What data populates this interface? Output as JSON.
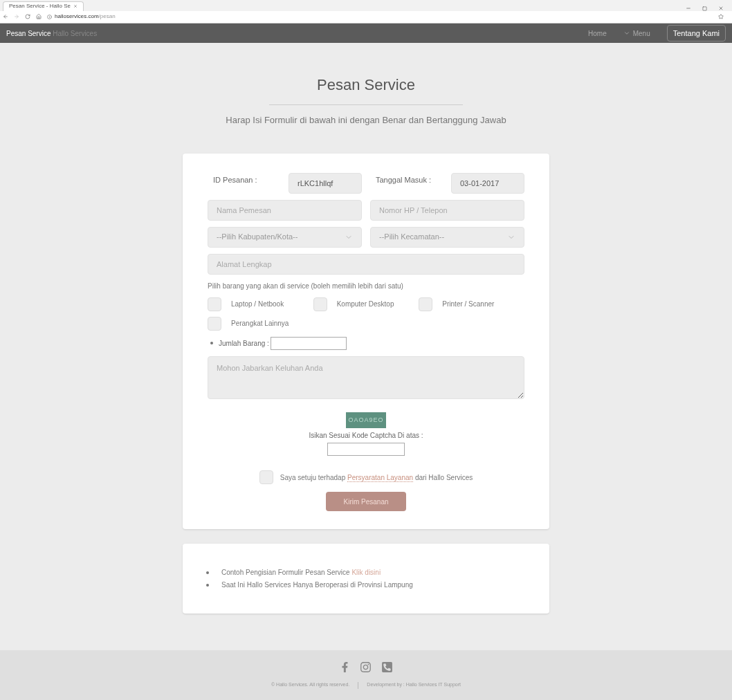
{
  "browser": {
    "tab_title": "Pesan Service - Hallo Se",
    "url_host": "halloservices.com",
    "url_path": "/pesan"
  },
  "navbar": {
    "brand": "Pesan Service",
    "brand_sub": "Hallo Services",
    "links": [
      {
        "label": "Home",
        "kind": "link"
      },
      {
        "label": "Menu",
        "kind": "dropdown"
      },
      {
        "label": "Tentang Kami",
        "kind": "button"
      }
    ]
  },
  "header": {
    "title": "Pesan Service",
    "subtitle": "Harap Isi Formulir di bawah ini dengan Benar dan Bertanggung Jawab"
  },
  "form": {
    "id_label": "ID Pesanan :",
    "id_value": "rLKC1hllqf",
    "date_label": "Tanggal Masuk :",
    "date_value": "03-01-2017",
    "name": {
      "placeholder": "Nama Pemesan"
    },
    "phone": {
      "placeholder": "Nomor HP / Telepon"
    },
    "city": {
      "value": "--Pilih Kabupaten/Kota--"
    },
    "district": {
      "value": "--Pilih Kecamatan--"
    },
    "address": {
      "placeholder": "Alamat Lengkap"
    },
    "items_label": "Pilih barang yang akan di service (boleh memilih lebih dari satu)",
    "items": [
      {
        "label": "Laptop / Netbook",
        "checked": false
      },
      {
        "label": "Komputer Desktop",
        "checked": false
      },
      {
        "label": "Printer / Scanner",
        "checked": false
      },
      {
        "label": "Perangkat Lainnya",
        "checked": false
      }
    ],
    "quantity_label": "Jumlah Barang :",
    "complaint": {
      "placeholder": "Mohon Jabarkan Keluhan Anda"
    },
    "captcha_code": "OAOA9EO",
    "captcha_label": "Isikan Sesuai Kode Captcha Di atas :",
    "agree": {
      "checked": false,
      "before": "Saya setuju terhadap",
      "link": "Persyaratan Layanan",
      "after": "dari Hallo Services"
    },
    "submit": "Kirim Pesanan"
  },
  "notes": [
    {
      "text": "Contoh Pengisian Formulir Pesan Service",
      "link": "Klik disini"
    },
    {
      "text": "Saat Ini Hallo Services Hanya Beroperasi di Provinsi Lampung"
    }
  ],
  "footer": {
    "copyright": "© Hallo Services. All rights reserved.",
    "credit": "Development by : Hallo Services IT Support"
  }
}
